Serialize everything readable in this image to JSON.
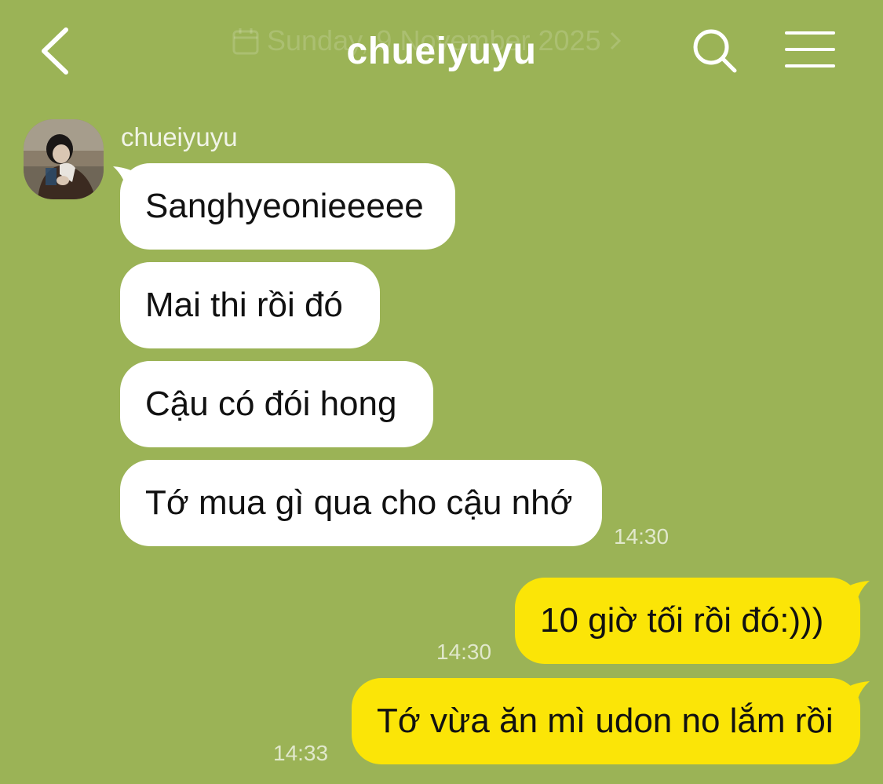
{
  "header": {
    "date_label": "Sunday, 9 November 2025",
    "title": "chueiyuyu"
  },
  "conversation": {
    "sender_name": "chueiyuyu",
    "messages": [
      {
        "text": "Sanghyeonieeeee"
      },
      {
        "text": "Mai thi rồi đó"
      },
      {
        "text": "Cậu có đói hong"
      },
      {
        "text": "Tớ mua gì qua cho cậu nhớ",
        "time": "14:30"
      },
      {
        "text": "10 giờ tối rồi đó:)))",
        "time": "14:30"
      },
      {
        "text": "Tớ vừa ăn mì udon no lắm rồi",
        "time": "14:33"
      }
    ]
  },
  "colors": {
    "background": "#9bb356",
    "incoming_bubble": "#ffffff",
    "outgoing_bubble": "#fbe507"
  },
  "icons": {
    "back": "chevron-left-icon",
    "calendar": "calendar-icon",
    "search": "search-icon",
    "menu": "hamburger-menu-icon"
  }
}
